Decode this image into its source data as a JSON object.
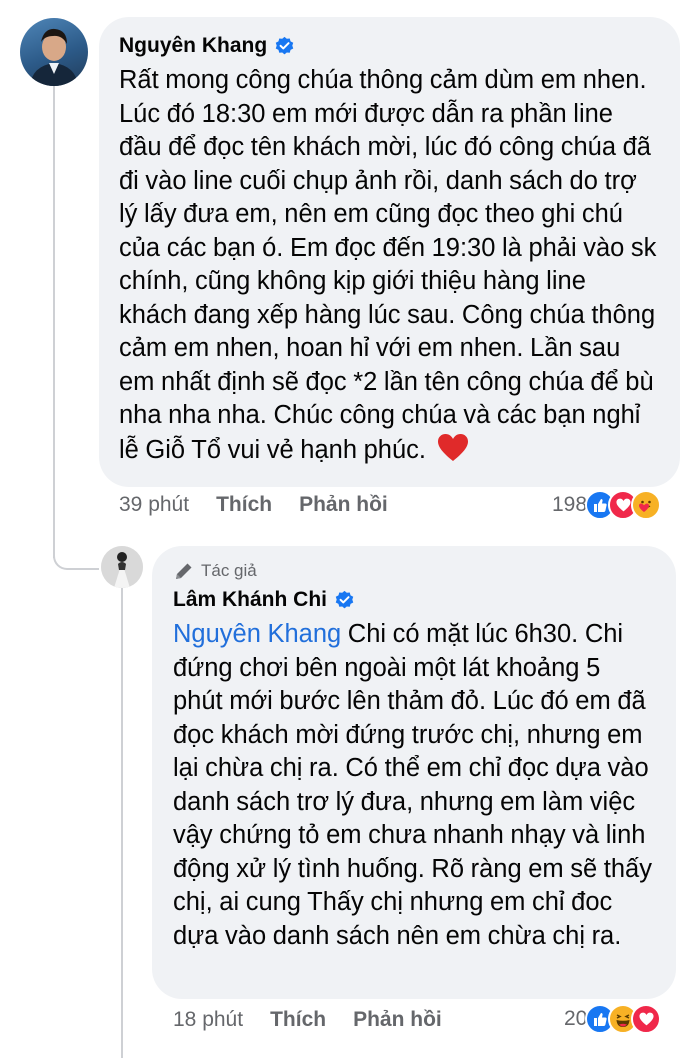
{
  "comments": [
    {
      "author": "Nguyên Khang",
      "text": "Rất mong công chúa thông cảm dùm em nhen. Lúc đó 18:30 em mới được dẫn ra phần line đầu để đọc tên khách mời, lúc đó công chúa đã đi vào line cuối chụp ảnh rồi, danh sách do trợ lý lấy đưa em, nên em cũng đọc theo ghi chú của các bạn ó. Em đọc đến 19:30 là phải vào sk chính, cũng không kịp giới thiệu hàng line khách đang xếp hàng lúc sau. Công chúa thông cảm em nhen, hoan hỉ với em nhen. Lần sau em nhất định sẽ đọc *2 lần tên công chúa để bù nha nha nha. Chúc công chúa và các bạn nghỉ lễ Giỗ Tổ vui vẻ hạnh phúc.",
      "emoji": "❤️",
      "time": "39 phút",
      "like_label": "Thích",
      "reply_label": "Phản hồi",
      "reaction_count": "198",
      "reactions": [
        "like-icon",
        "love-icon",
        "care-icon"
      ]
    },
    {
      "badge": "Tác giả",
      "author": "Lâm Khánh Chi",
      "mention": "Nguyên Khang",
      "text": " Chi có mặt lúc 6h30. Chi đứng chơi bên ngoài một lát khoảng 5 phút mới bước lên thảm đỏ. Lúc đó em đã đọc khách mời đứng trước chị, nhưng em lại chừa chị ra. Có thể em chỉ đọc dựa vào danh sách trơ lý đưa, nhưng em làm việc vậy chứng tỏ em chưa nhanh nhạy và linh động xử lý tình huống. Rõ ràng em sẽ thấy chị, ai cung Thấy chị nhưng em chỉ đoc dựa vào danh sách nên em chừa chị ra.",
      "time": "18 phút",
      "like_label": "Thích",
      "reply_label": "Phản hồi",
      "reaction_count": "20",
      "reactions": [
        "like-icon",
        "haha-icon",
        "love-icon"
      ]
    }
  ],
  "colors": {
    "bubble": "#f0f2f5",
    "mention": "#216fdb",
    "verified": "#1877f2",
    "meta": "#65676b"
  }
}
